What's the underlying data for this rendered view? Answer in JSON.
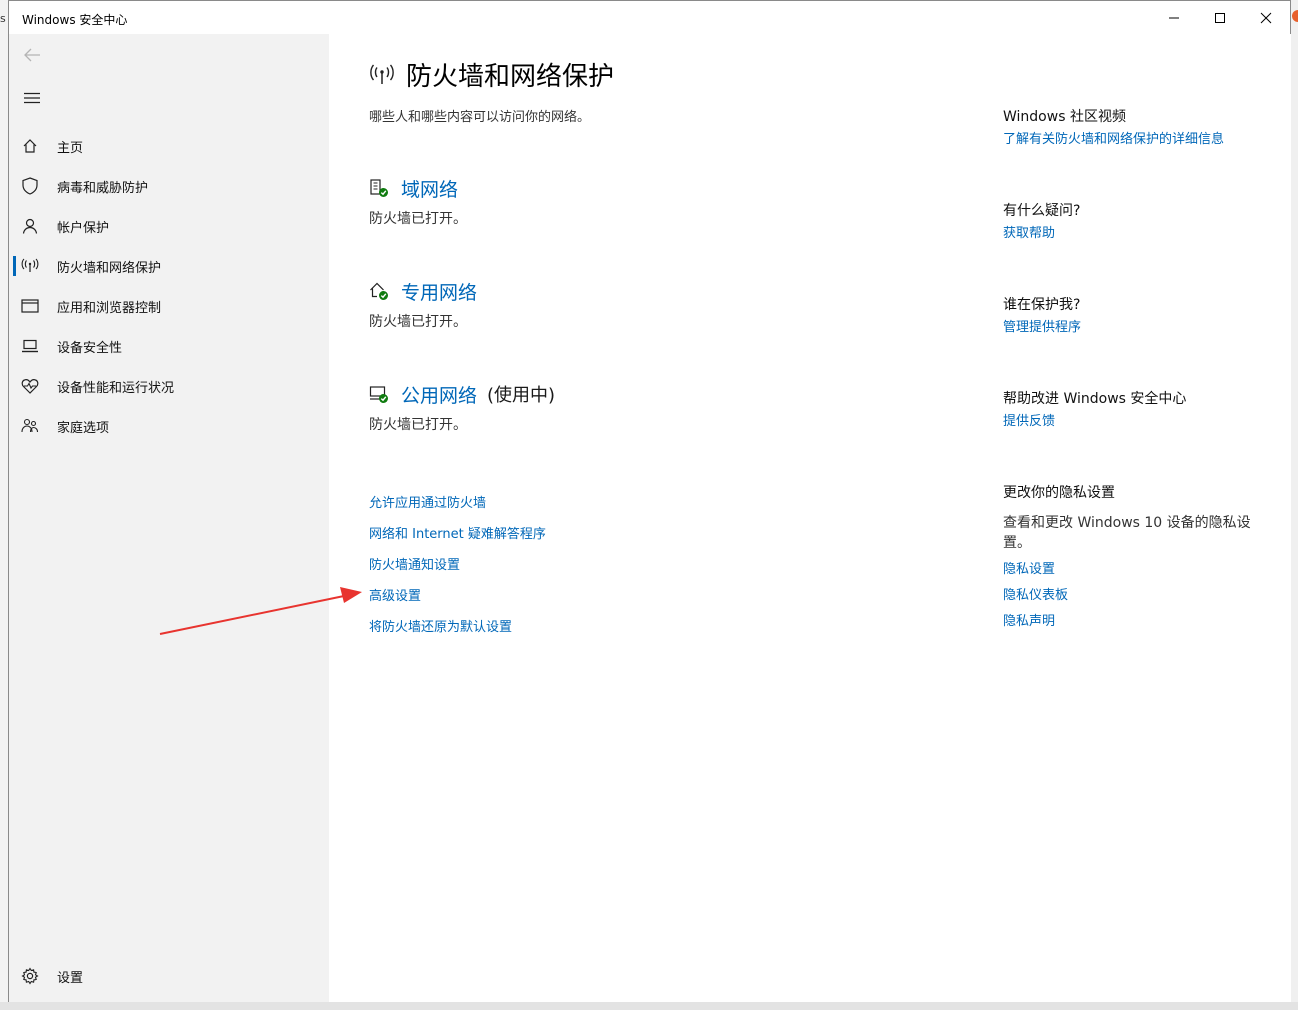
{
  "window": {
    "title": "Windows 安全中心",
    "background_fragment": "s"
  },
  "sidebar": {
    "items": [
      {
        "label": "主页",
        "icon": "home-icon"
      },
      {
        "label": "病毒和威胁防护",
        "icon": "shield-icon"
      },
      {
        "label": "帐户保护",
        "icon": "person-icon"
      },
      {
        "label": "防火墙和网络保护",
        "icon": "wifi-antenna-icon",
        "active": true
      },
      {
        "label": "应用和浏览器控制",
        "icon": "browser-window-icon"
      },
      {
        "label": "设备安全性",
        "icon": "laptop-icon"
      },
      {
        "label": "设备性能和运行状况",
        "icon": "heart-pulse-icon"
      },
      {
        "label": "家庭选项",
        "icon": "family-icon"
      }
    ],
    "settings_label": "设置"
  },
  "main": {
    "title": "防火墙和网络保护",
    "subtitle": "哪些人和哪些内容可以访问你的网络。",
    "networks": [
      {
        "name": "域网络",
        "status": "防火墙已打开。",
        "suffix": "",
        "icon": "domain-network-icon"
      },
      {
        "name": "专用网络",
        "status": "防火墙已打开。",
        "suffix": "",
        "icon": "private-network-icon"
      },
      {
        "name": "公用网络",
        "status": "防火墙已打开。",
        "suffix": "(使用中)",
        "icon": "public-network-icon"
      }
    ],
    "links": [
      "允许应用通过防火墙",
      "网络和 Internet 疑难解答程序",
      "防火墙通知设置",
      "高级设置",
      "将防火墙还原为默认设置"
    ]
  },
  "right_panel": {
    "community": {
      "heading": "Windows 社区视频",
      "link": "了解有关防火墙和网络保护的详细信息"
    },
    "question": {
      "heading": "有什么疑问?",
      "link": "获取帮助"
    },
    "protector": {
      "heading": "谁在保护我?",
      "link": "管理提供程序"
    },
    "improve": {
      "heading": "帮助改进 Windows 安全中心",
      "link": "提供反馈"
    },
    "privacy": {
      "heading": "更改你的隐私设置",
      "description": "查看和更改 Windows 10 设备的隐私设置。",
      "links": [
        "隐私设置",
        "隐私仪表板",
        "隐私声明"
      ]
    }
  },
  "colors": {
    "accent": "#0067b8",
    "sidebar_bg": "#f2f2f2",
    "status_ok": "#107c10",
    "annotation_arrow": "#e8342f"
  }
}
